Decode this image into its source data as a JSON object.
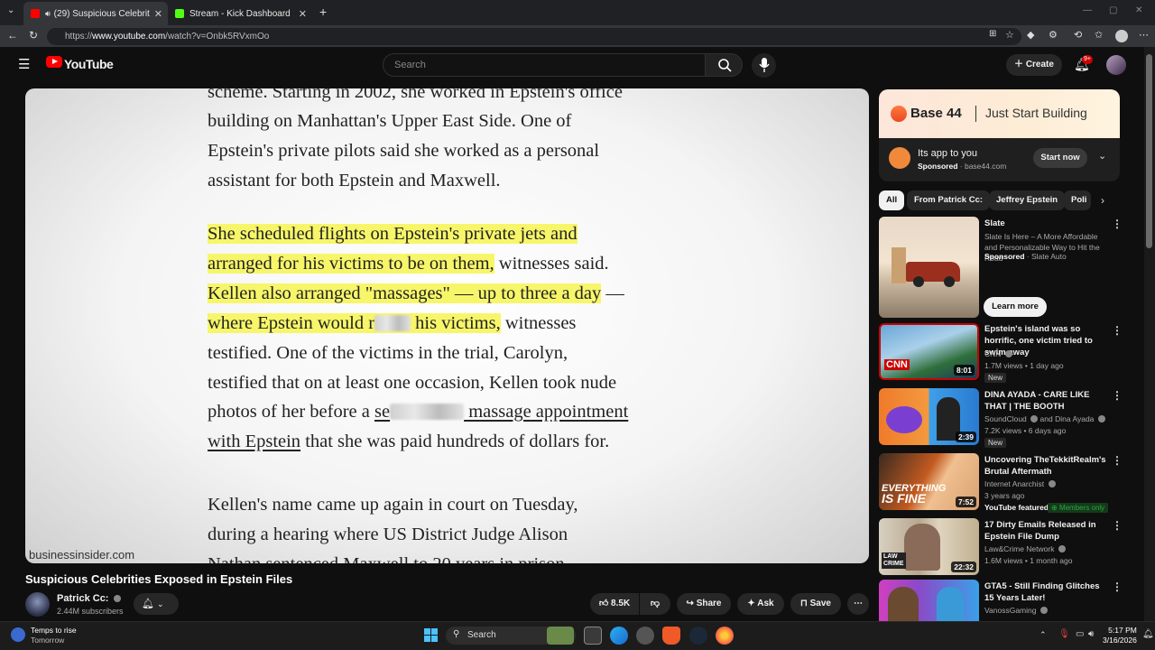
{
  "browser": {
    "tabs": [
      {
        "label": "(29) Suspicious Celebrities Exp",
        "active": true
      },
      {
        "label": "Stream - Kick Dashboard",
        "active": false
      }
    ],
    "url_prefix": "https://",
    "url_host": "www.youtube.com",
    "url_path": "/watch?v=Onbk5RVxmOo"
  },
  "youtube": {
    "logo_text": "YouTube",
    "search_placeholder": "Search",
    "create_label": "Create",
    "notif_count": "9+"
  },
  "article": {
    "lines": [
      "scheme. Starting in 2002, she worked in Epstein's office",
      "building on Manhattan's Upper East Side. One of",
      "Epstein's private pilots said she worked as a personal",
      "assistant for both Epstein and Maxwell."
    ],
    "hl1": "She scheduled flights on Epstein's private jets and",
    "hl2": "arranged for his victims to be on them,",
    "hl2_rest": " witnesses said.",
    "hl3": "Kellen also arranged \"massages\" — up to three a day",
    "hl3_rest": " —",
    "hl4a": "where Epstein would r",
    "hl4b": " his victims,",
    "hl4_rest": " witnesses",
    "l5": "testified. One of the victims in the trial, Carolyn,",
    "l6": "testified that on at least one occasion, Kellen took nude",
    "l7a": "photos of her before a ",
    "l7_link1": "se",
    "l7_link2": " massage appointment",
    "l8_link": "with Epstein",
    "l8_rest": " that she was paid hundreds of dollars for.",
    "l9": "Kellen's name came up again in court on Tuesday,",
    "l10": "during a hearing where US District Judge Alison",
    "l11": "Nathan sentenced Maxwell to 20 years in prison",
    "watermark": "businessinsider.com"
  },
  "video": {
    "title": "Suspicious Celebrities Exposed in Epstein Files",
    "channel": "Patrick Cc:",
    "subscribers": "2.44M subscribers",
    "likes": "8.5K",
    "share": "Share",
    "ask": "Ask",
    "save": "Save"
  },
  "ad": {
    "brand": "Base 44",
    "tagline": "Just Start Building",
    "line1": "Its app to you",
    "sponsored": "Sponsored",
    "domain": "base44.com",
    "cta": "Start now"
  },
  "chips": [
    "All",
    "From Patrick Cc:",
    "Jeffrey Epstein",
    "Poli"
  ],
  "recommended": [
    {
      "title": "Slate",
      "desc": "Slate Is Here – A More Affordable and Personalizable Way to Hit the Road",
      "sponsored": "Sponsored",
      "channel": "Slate Auto",
      "cta": "Learn more"
    },
    {
      "title": "Epstein's island was so horrific, one victim tried to swim away",
      "channel": "CNN",
      "meta": "1.7M views • 1 day ago",
      "badge": "New",
      "duration": "8:01"
    },
    {
      "title": "DINA AYADA - CARE LIKE THAT | THE BOOTH",
      "channel": "SoundCloud",
      "channel2": "and Dina Ayada",
      "meta": "7.2K views • 6 days ago",
      "badge": "New",
      "duration": "2:39"
    },
    {
      "title": "Uncovering TheTekkitRealm's Brutal Aftermath",
      "channel": "Internet Anarchist",
      "meta": "3 years ago",
      "featured": "YouTube featured",
      "members": "Members only",
      "duration": "7:52"
    },
    {
      "title": "17 Dirty Emails Released in Epstein File Dump",
      "channel": "Law&Crime Network",
      "meta": "1.6M views • 1 month ago",
      "duration": "22:32"
    },
    {
      "title": "GTA5 - Still Finding Glitches 15 Years Later!",
      "channel": "VanossGaming"
    }
  ],
  "taskbar": {
    "weather_title": "Temps to rise",
    "weather_sub": "Tomorrow",
    "search": "Search",
    "time": "5:17 PM",
    "date": "3/16/2026"
  }
}
